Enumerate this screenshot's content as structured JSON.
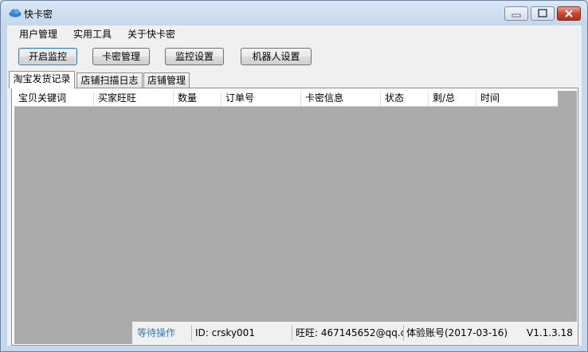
{
  "window": {
    "title": "快卡密",
    "icon": "cloud-icon"
  },
  "menu": [
    "用户管理",
    "实用工具",
    "关于快卡密"
  ],
  "toolbar": {
    "start_monitor": "开启监控",
    "card_manage": "卡密管理",
    "monitor_settings": "监控设置",
    "robot_settings": "机器人设置"
  },
  "tabs": [
    "淘宝发货记录",
    "店铺扫描日志",
    "店铺管理"
  ],
  "grid": {
    "columns": [
      "宝贝关键词",
      "买家旺旺",
      "数量",
      "订单号",
      "卡密信息",
      "状态",
      "剩/总",
      "时间"
    ]
  },
  "status": {
    "state": "等待操作",
    "id": "ID:  crsky001",
    "wangwang": "旺旺:  467145652@qq.c",
    "account": "体验账号(2017-03-16)",
    "version": "V1.1.3.18"
  },
  "colors": {
    "status_state": "#3a78c3",
    "grid_bg": "#ababab"
  }
}
